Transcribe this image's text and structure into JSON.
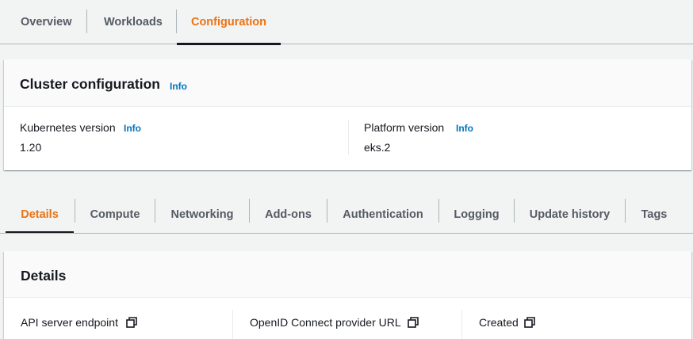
{
  "top_tabs": [
    {
      "label": "Overview",
      "active": false
    },
    {
      "label": "Workloads",
      "active": false
    },
    {
      "label": "Configuration",
      "active": true
    }
  ],
  "cluster_config": {
    "title": "Cluster configuration",
    "info": "Info",
    "fields": [
      {
        "label": "Kubernetes version",
        "info": "Info",
        "value": "1.20"
      },
      {
        "label": "Platform version",
        "info": "Info",
        "value": "eks.2"
      }
    ]
  },
  "detail_tabs": [
    {
      "label": "Details",
      "active": true
    },
    {
      "label": "Compute",
      "active": false
    },
    {
      "label": "Networking",
      "active": false
    },
    {
      "label": "Add-ons",
      "active": false
    },
    {
      "label": "Authentication",
      "active": false
    },
    {
      "label": "Logging",
      "active": false
    },
    {
      "label": "Update history",
      "active": false
    },
    {
      "label": "Tags",
      "active": false
    }
  ],
  "details": {
    "title": "Details",
    "fields": [
      {
        "label": "API server endpoint",
        "icon": "copy-icon"
      },
      {
        "label": "OpenID Connect provider URL",
        "icon": "copy-icon"
      },
      {
        "label": "Created",
        "icon": "copy-icon"
      }
    ]
  },
  "colors": {
    "accent": "#ec7211",
    "link": "#0073bb",
    "text": "#16191f",
    "muted": "#545b64"
  }
}
